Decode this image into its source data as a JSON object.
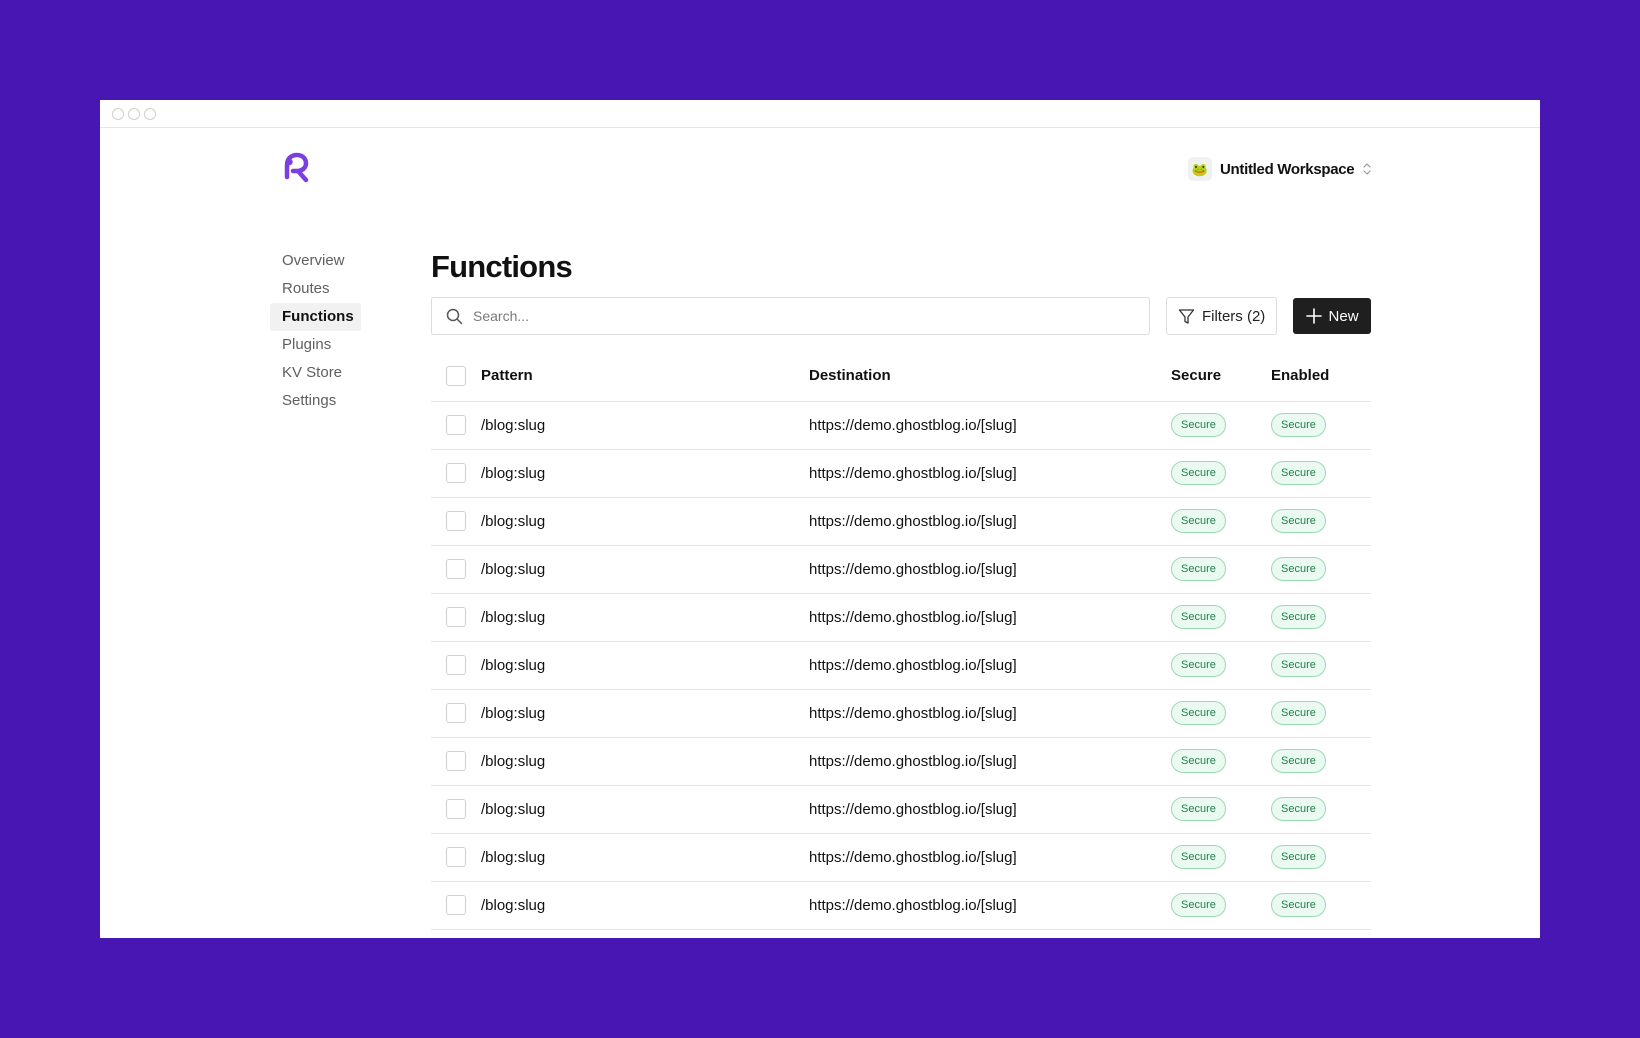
{
  "colors": {
    "background": "#4716b3",
    "brand": "#7a3fe0",
    "badge_bg": "#eafaf0",
    "badge_text": "#22824b",
    "primary_button": "#1f1f1f"
  },
  "workspace": {
    "name": "Untitled Workspace",
    "avatar_icon": "frog-emoji-icon",
    "avatar_glyph": "🐸"
  },
  "sidebar": {
    "items": [
      {
        "label": "Overview",
        "active": false
      },
      {
        "label": "Routes",
        "active": false
      },
      {
        "label": "Functions",
        "active": true
      },
      {
        "label": "Plugins",
        "active": false
      },
      {
        "label": "KV Store",
        "active": false
      },
      {
        "label": "Settings",
        "active": false
      }
    ]
  },
  "main": {
    "title": "Functions",
    "search": {
      "placeholder": "Search..."
    },
    "filters_label": "Filters (2)",
    "new_label": "New"
  },
  "table": {
    "columns": [
      "Pattern",
      "Destination",
      "Secure",
      "Enabled"
    ],
    "rows": [
      {
        "pattern": "/blog:slug",
        "destination": "https://demo.ghostblog.io/[slug]",
        "secure": "Secure",
        "enabled": "Secure"
      },
      {
        "pattern": "/blog:slug",
        "destination": "https://demo.ghostblog.io/[slug]",
        "secure": "Secure",
        "enabled": "Secure"
      },
      {
        "pattern": "/blog:slug",
        "destination": "https://demo.ghostblog.io/[slug]",
        "secure": "Secure",
        "enabled": "Secure"
      },
      {
        "pattern": "/blog:slug",
        "destination": "https://demo.ghostblog.io/[slug]",
        "secure": "Secure",
        "enabled": "Secure"
      },
      {
        "pattern": "/blog:slug",
        "destination": "https://demo.ghostblog.io/[slug]",
        "secure": "Secure",
        "enabled": "Secure"
      },
      {
        "pattern": "/blog:slug",
        "destination": "https://demo.ghostblog.io/[slug]",
        "secure": "Secure",
        "enabled": "Secure"
      },
      {
        "pattern": "/blog:slug",
        "destination": "https://demo.ghostblog.io/[slug]",
        "secure": "Secure",
        "enabled": "Secure"
      },
      {
        "pattern": "/blog:slug",
        "destination": "https://demo.ghostblog.io/[slug]",
        "secure": "Secure",
        "enabled": "Secure"
      },
      {
        "pattern": "/blog:slug",
        "destination": "https://demo.ghostblog.io/[slug]",
        "secure": "Secure",
        "enabled": "Secure"
      },
      {
        "pattern": "/blog:slug",
        "destination": "https://demo.ghostblog.io/[slug]",
        "secure": "Secure",
        "enabled": "Secure"
      },
      {
        "pattern": "/blog:slug",
        "destination": "https://demo.ghostblog.io/[slug]",
        "secure": "Secure",
        "enabled": "Secure"
      }
    ]
  }
}
